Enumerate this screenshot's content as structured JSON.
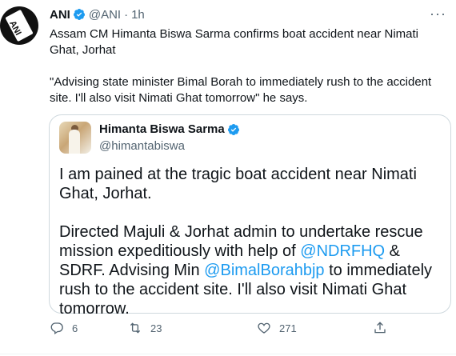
{
  "tweet": {
    "author_name": "ANI",
    "author_handle": "@ANI",
    "separator": "·",
    "time": "1h",
    "more": "···",
    "text_line1": "Assam CM Himanta Biswa Sarma confirms boat accident near Nimati Ghat, Jorhat",
    "text_line2": "\"Advising state minister Bimal Borah to immediately rush to the accident site. I'll also visit Nimati Ghat tomorrow\" he says.",
    "avatar_text": "ANI"
  },
  "quote": {
    "author_name": "Himanta Biswa Sarma",
    "author_handle": "@himantabiswa",
    "para1": "I am pained at the tragic boat accident near Nimati Ghat, Jorhat.",
    "para2_a": "Directed Majuli & Jorhat admin to undertake rescue mission expeditiously with help of ",
    "mention1": "@NDRFHQ",
    "para2_b": " & SDRF. Advising Min ",
    "mention2": "@BimalBorahbjp",
    "para2_c": " to immediately rush to the accident site. I'll also visit Nimati Ghat tomorrow."
  },
  "actions": {
    "replies": "6",
    "retweets": "23",
    "likes": "271"
  },
  "colors": {
    "verified": "#1d9bf0",
    "link": "#1d9bf0",
    "secondary": "#536471"
  }
}
